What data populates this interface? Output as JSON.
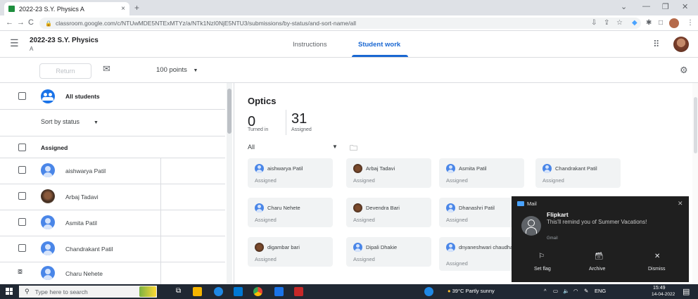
{
  "browser": {
    "tab_title": "2022-23 S.Y. Physics A",
    "tab_close": "×",
    "new_tab": "+",
    "url": "classroom.google.com/c/NTUwMDE5NTExMTYz/a/NTk1NzI0NjE5NTU3/submissions/by-status/and-sort-name/all",
    "win_min": "—",
    "win_max": "❐",
    "win_close": "✕",
    "back": "←",
    "forward": "→",
    "reload": "C"
  },
  "header": {
    "class_title": "2022-23 S.Y. Physics",
    "class_section": "A",
    "tabs": [
      {
        "label": "Instructions"
      },
      {
        "label": "Student work"
      }
    ]
  },
  "toolbar": {
    "return_label": "Return",
    "points": "100 points"
  },
  "left_panel": {
    "all_students": "All students",
    "sort_label": "Sort by status",
    "group_label": "Assigned",
    "students": [
      {
        "name": "aishwarya Patil",
        "photo": false
      },
      {
        "name": "Arbaj Tadavi",
        "photo": true
      },
      {
        "name": "Asmita Patil",
        "photo": false
      },
      {
        "name": "Chandrakant Patil",
        "photo": false
      },
      {
        "name": "Charu Nehete",
        "photo": false
      }
    ]
  },
  "main": {
    "assignment_title": "Optics",
    "turned_in_count": "0",
    "turned_in_label": "Turned in",
    "assigned_count": "31",
    "assigned_label": "Assigned",
    "filter": "All",
    "cards": [
      {
        "name": "aishwarya Patil",
        "status": "Assigned",
        "photo": false
      },
      {
        "name": "Arbaj Tadavi",
        "status": "Assigned",
        "photo": true
      },
      {
        "name": "Asmita Patil",
        "status": "Assigned",
        "photo": false
      },
      {
        "name": "Chandrakant Patil",
        "status": "Assigned",
        "photo": false
      },
      {
        "name": "Charu Nehete",
        "status": "Assigned",
        "photo": false
      },
      {
        "name": "Devendra Bari",
        "status": "Assigned",
        "photo": true
      },
      {
        "name": "Dhanashri Patil",
        "status": "Assigned",
        "photo": false
      },
      {
        "name": "digambar bari",
        "status": "Assigned",
        "photo": true
      },
      {
        "name": "Dipali Dhakie",
        "status": "Assigned",
        "photo": false
      },
      {
        "name": "dnyaneshwari chaudhari",
        "status": "Assigned",
        "photo": false
      }
    ]
  },
  "toast": {
    "app": "Mail",
    "sender": "Flipkart",
    "message": "This'll remind you of Summer Vacations!",
    "source": "Gmail",
    "actions": [
      {
        "label": "Set flag",
        "icon": "⚐"
      },
      {
        "label": "Archive",
        "icon": "🗃"
      },
      {
        "label": "Dismiss",
        "icon": "✕"
      }
    ]
  },
  "taskbar": {
    "search_placeholder": "Type here to search",
    "weather": "39°C  Partly sunny",
    "tray": "ENG",
    "time": "15:49",
    "date": "14-04-2022"
  }
}
